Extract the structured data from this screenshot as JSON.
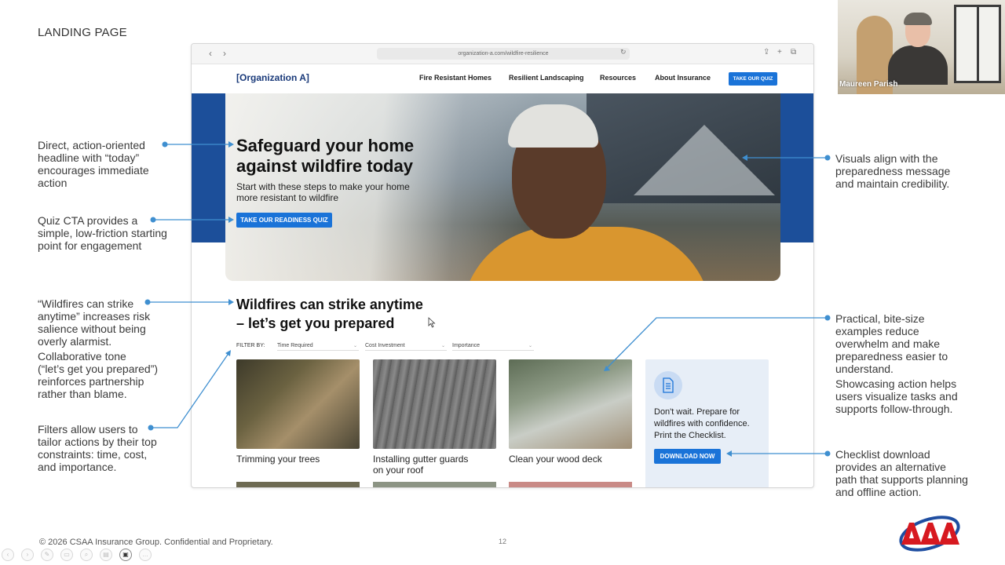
{
  "slide": {
    "title": "LANDING PAGE",
    "footer": "© 2026 CSAA Insurance Group. Confidential and Proprietary.",
    "page_number": "12"
  },
  "annotations": {
    "headline": [
      "Direct, action-oriented",
      "headline with “today”",
      "encourages immediate",
      "action"
    ],
    "quiz_cta": [
      "Quiz CTA provides a",
      "simple, low-friction starting",
      "point for engagement"
    ],
    "salience": [
      "“Wildfires can strike",
      "anytime” increases risk",
      "salience without being",
      "overly alarmist."
    ],
    "tone": [
      "Collaborative tone",
      "(“let’s get you prepared”)",
      "reinforces partnership",
      "rather than blame."
    ],
    "filters": [
      "Filters allow users to",
      "tailor actions by their top",
      "constraints: time, cost,",
      "and importance."
    ],
    "visuals": [
      "Visuals align with the",
      "preparedness message",
      "and maintain credibility."
    ],
    "examples": [
      "Practical, bite-size",
      "examples reduce",
      "overwhelm and make",
      "preparedness easier to",
      "understand."
    ],
    "showcasing": [
      "Showcasing action helps",
      "users visualize tasks and",
      "supports follow-through."
    ],
    "checklist": [
      "Checklist download",
      "provides an alternative",
      "path that supports planning",
      "and offline action."
    ]
  },
  "browser": {
    "url": "organization-a.com/wildfire-resilience",
    "back_icon": "chevron-left-icon",
    "forward_icon": "chevron-right-icon"
  },
  "site": {
    "logo": "[Organization A]",
    "nav": [
      "Fire Resistant Homes",
      "Resilient Landscaping",
      "Resources",
      "About Insurance"
    ],
    "nav_cta": "TAKE OUR QUIZ",
    "hero": {
      "title_lines": [
        "Safeguard your home",
        "against wildfire today"
      ],
      "subtitle_lines": [
        "Start with these steps to make your home",
        "more resistant to wildfire"
      ],
      "cta": "TAKE OUR READINESS QUIZ"
    },
    "section": {
      "title_lines": [
        "Wildfires can strike anytime",
        "– let’s get you prepared"
      ],
      "filter_label": "FILTER BY:",
      "filters": [
        "Time Required",
        "Cost Investment",
        "Importance"
      ]
    },
    "cards": [
      {
        "label_lines": [
          "Trimming your trees"
        ]
      },
      {
        "label_lines": [
          "Installing gutter guards",
          "on your roof"
        ]
      },
      {
        "label_lines": [
          "Clean your wood deck"
        ]
      }
    ],
    "checklist_card": {
      "text_lines": [
        "Don't wait. Prepare for",
        "wildfires with confidence.",
        "Print the Checklist."
      ],
      "button": "DOWNLOAD NOW"
    }
  },
  "video": {
    "participant": "Maureen Parish"
  },
  "colors": {
    "accent_blue": "#1a73d8",
    "band_blue": "#1c4f9a",
    "connector": "#3f8fd0",
    "aaa_red": "#d71920",
    "aaa_blue": "#1f4ea1"
  }
}
